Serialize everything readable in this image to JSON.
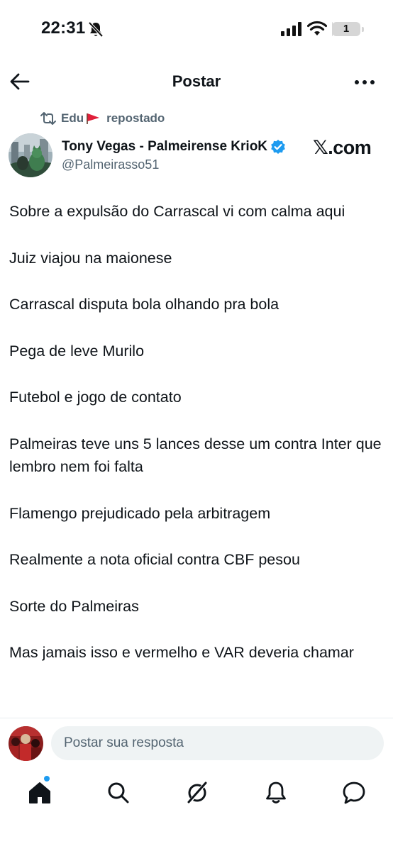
{
  "status_bar": {
    "time": "22:31",
    "battery_percent": "1",
    "battery_level": 0.01,
    "icons": [
      "bell-slash-icon",
      "signal-icon",
      "wifi-icon",
      "battery-icon"
    ]
  },
  "header": {
    "title": "Postar",
    "back_icon": "arrow-left-icon",
    "more_icon": "more-horizontal-icon"
  },
  "repost": {
    "user": "Edu",
    "label": "repostado",
    "icon": "repost-icon",
    "flag_icon": "red-flag-icon"
  },
  "author": {
    "name": "Tony Vegas - Palmeirense KrioK",
    "handle": "@Palmeirasso51",
    "verified_icon": "verified-badge-icon",
    "verified_color": "#1d9bf0"
  },
  "watermark": {
    "x": "𝕏",
    "domain": ".com"
  },
  "post": {
    "paragraphs": [
      "Sobre a expulsão do Carrascal vi com calma aqui",
      "Juiz viajou na maionese",
      "Carrascal disputa bola olhando pra bola",
      "Pega de leve Murilo",
      "Futebol e jogo de contato",
      "Palmeiras teve uns 5 lances desse um contra Inter que lembro nem foi falta",
      "Flamengo prejudicado pela arbitragem",
      "Realmente a nota oficial contra CBF pesou",
      "Sorte do Palmeiras",
      "Mas jamais isso e vermelho e VAR deveria chamar"
    ]
  },
  "reply": {
    "placeholder": "Postar sua resposta"
  },
  "bottom_nav": {
    "items": [
      "home-icon",
      "search-icon",
      "grok-icon",
      "notifications-bell-icon",
      "messages-icon"
    ],
    "active": "home-icon",
    "accent": "#1d9bf0"
  },
  "colors": {
    "text": "#0f1419",
    "secondary": "#536471",
    "accent": "#1d9bf0",
    "input_bg": "#eff3f4"
  }
}
